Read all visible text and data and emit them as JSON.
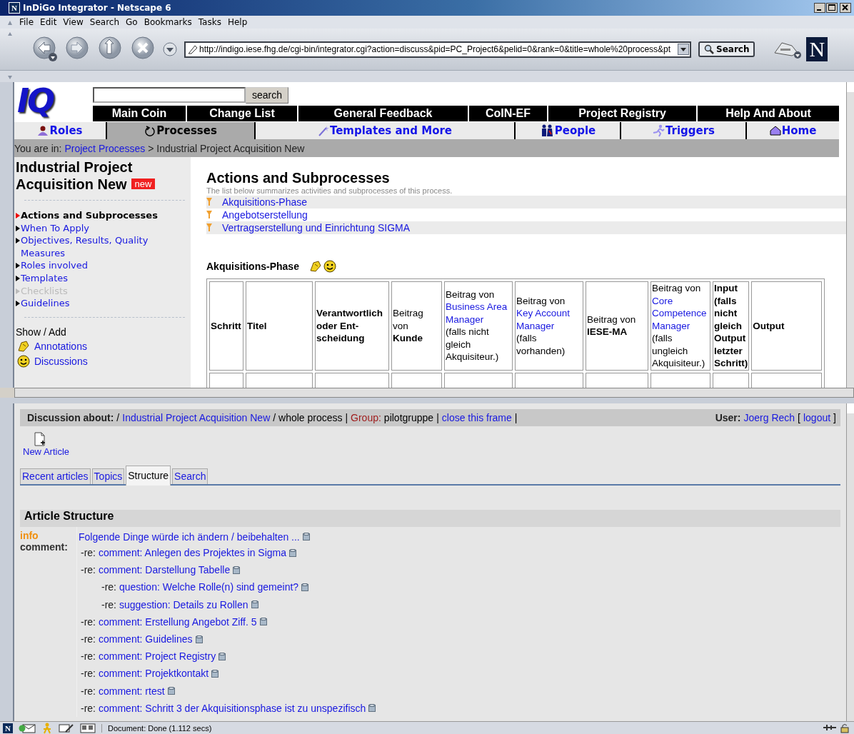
{
  "window": {
    "icon": "N",
    "title": "InDiGo Integrator - Netscape 6"
  },
  "menu": [
    "File",
    "Edit",
    "View",
    "Search",
    "Go",
    "Bookmarks",
    "Tasks",
    "Help"
  ],
  "toolbar": {
    "address": "http://indigo.iese.fhg.de/cgi-bin/integrator.cgi?action=discuss&pid=PC_Project6&pelid=0&rank=0&title=whole%20process&pt",
    "search_button": "Search",
    "logo": "N"
  },
  "site": {
    "logo": "IQ",
    "search_button": "search",
    "nav": [
      "Main Coin",
      "Change List",
      "General Feedback",
      "CoIN-EF",
      "Project Registry",
      "Help And About"
    ],
    "tabs": [
      {
        "label": "Roles",
        "kind": "roles",
        "selected": false
      },
      {
        "label": "Processes",
        "kind": "processes",
        "selected": true
      },
      {
        "label": "Templates and More",
        "kind": "templates",
        "selected": false
      },
      {
        "label": "People",
        "kind": "people",
        "selected": false
      },
      {
        "label": "Triggers",
        "kind": "triggers",
        "selected": false
      },
      {
        "label": "Home",
        "kind": "home",
        "selected": false
      }
    ]
  },
  "breadcrumb": {
    "label": "You are in:",
    "link": "Project Processes",
    "current": "> Industrial Project Acquisition New"
  },
  "sidebar": {
    "title": "Industrial Project Acquisition New",
    "badge": "new",
    "items": [
      {
        "label": "Actions and Subprocesses",
        "selected": true,
        "disabled": false
      },
      {
        "label": "When To Apply",
        "selected": false,
        "disabled": false
      },
      {
        "label": "Objectives, Results, Quality Measures",
        "selected": false,
        "disabled": false
      },
      {
        "label": "Roles involved",
        "selected": false,
        "disabled": false
      },
      {
        "label": "Templates",
        "selected": false,
        "disabled": false
      },
      {
        "label": "Checklists",
        "selected": false,
        "disabled": true
      },
      {
        "label": "Guidelines",
        "selected": false,
        "disabled": false
      }
    ],
    "show_add_label": "Show / Add",
    "show_add": [
      {
        "label": "Annotations",
        "kind": "annotations"
      },
      {
        "label": "Discussions",
        "kind": "discussions"
      }
    ]
  },
  "content": {
    "heading": "Actions and Subprocesses",
    "intro": "The list below summarizes activities and subprocesses of this process.",
    "subprocesses": [
      "Akquisitions-Phase",
      "Angebotserstellung",
      "Vertragserstellung und Einrichtung SIGMA"
    ],
    "phase_title": "Akquisitions-Phase",
    "table": {
      "columns": [
        [
          {
            "text": "Schritt",
            "kind": "bold"
          }
        ],
        [
          {
            "text": "Titel",
            "kind": "bold"
          }
        ],
        [
          {
            "text": "Verantwortlich oder Ent-scheidung",
            "kind": "bold"
          }
        ],
        [
          {
            "text": "Beitrag von",
            "kind": "plain"
          },
          {
            "text": "Kunde",
            "kind": "bold"
          }
        ],
        [
          {
            "text": "Beitrag von",
            "kind": "plain"
          },
          {
            "text": "Business Area Manager",
            "kind": "link"
          },
          {
            "text": "(falls nicht gleich Akquisiteur.)",
            "kind": "plain"
          }
        ],
        [
          {
            "text": "Beitrag von",
            "kind": "plain"
          },
          {
            "text": "Key Account Manager",
            "kind": "link"
          },
          {
            "text": "(falls vorhanden)",
            "kind": "plain"
          }
        ],
        [
          {
            "text": "Beitrag von",
            "kind": "plain"
          },
          {
            "text": "IESE-MA",
            "kind": "bold"
          }
        ],
        [
          {
            "text": "Beitrag von",
            "kind": "plain"
          },
          {
            "text": "Core Competence Manager",
            "kind": "link"
          },
          {
            "text": "(falls ungleich Akquisiteur.)",
            "kind": "plain"
          }
        ],
        [
          {
            "text": "Input (falls nicht gleich Output letzter Schritt)",
            "kind": "bold"
          }
        ],
        [
          {
            "text": "Output",
            "kind": "bold"
          }
        ]
      ]
    }
  },
  "discussion": {
    "about": [
      {
        "text": "Discussion about:",
        "kind": "bold"
      },
      {
        "text": "/",
        "kind": "plain"
      },
      {
        "text": "Industrial Project Acquisition New",
        "kind": "link"
      },
      {
        "text": "/ whole process |",
        "kind": "plain"
      },
      {
        "text": "Group:",
        "kind": "label"
      },
      {
        "text": "pilotgruppe",
        "kind": "plain"
      },
      {
        "text": "|",
        "kind": "plain"
      },
      {
        "text": "close this frame",
        "kind": "link"
      },
      {
        "text": "|",
        "kind": "plain"
      }
    ],
    "user": [
      {
        "text": "User:",
        "kind": "bold"
      },
      {
        "text": "Joerg Rech",
        "kind": "link"
      },
      {
        "text": "[",
        "kind": "plain"
      },
      {
        "text": "logout",
        "kind": "link"
      },
      {
        "text": "]",
        "kind": "plain"
      }
    ],
    "new_article": "New Article",
    "tabs": [
      {
        "label": "Recent articles",
        "selected": false
      },
      {
        "label": "Topics",
        "selected": false
      },
      {
        "label": "Structure",
        "selected": true
      },
      {
        "label": "Search",
        "selected": false
      }
    ],
    "structure": {
      "title": "Article Structure",
      "type": "info",
      "type_caption": "comment:",
      "articles": [
        {
          "title": "Folgende Dinge würde ich ändern / beibehalten ...",
          "children": [
            {
              "prefix": "-re:",
              "title": "comment: Anlegen des Projektes in Sigma"
            },
            {
              "prefix": "-re:",
              "title": "comment: Darstellung Tabelle",
              "children": [
                {
                  "prefix": "-re:",
                  "title": "question: Welche Rolle(n) sind gemeint?"
                },
                {
                  "prefix": "-re:",
                  "title": "suggestion: Details zu Rollen"
                }
              ]
            },
            {
              "prefix": "-re:",
              "title": "comment: Erstellung Angebot Ziff. 5"
            },
            {
              "prefix": "-re:",
              "title": "comment: Guidelines"
            },
            {
              "prefix": "-re:",
              "title": "comment: Project Registry"
            },
            {
              "prefix": "-re:",
              "title": "comment: Projektkontakt"
            },
            {
              "prefix": "-re:",
              "title": "comment: rtest"
            },
            {
              "prefix": "-re:",
              "title": "comment: Schritt 3 der Akquisitionsphase ist zu unspezifisch"
            }
          ]
        }
      ]
    }
  },
  "status_bar": {
    "logo": "N",
    "text": "Document: Done (1.112 secs)"
  }
}
